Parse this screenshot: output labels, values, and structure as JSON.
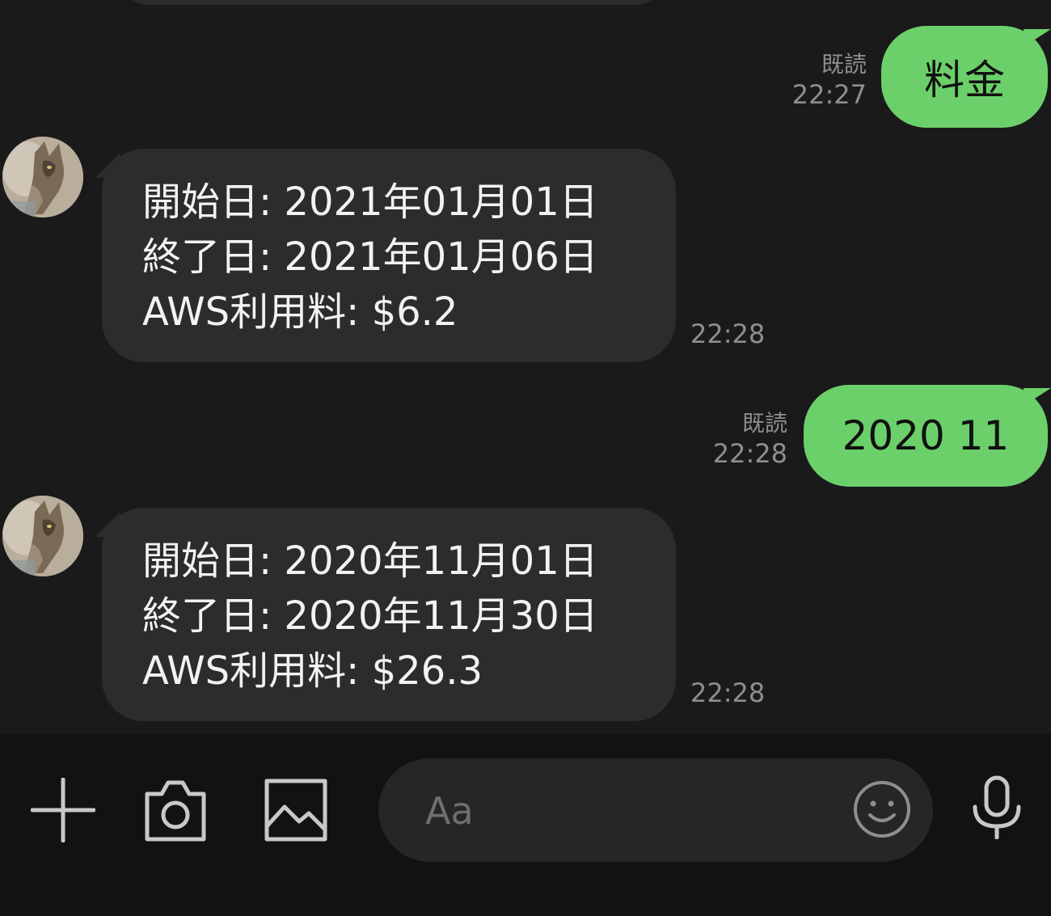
{
  "colors": {
    "background": "#1a1a1a",
    "outgoing_bubble": "#6bd06a",
    "incoming_bubble": "#2c2c2c",
    "meta_text": "#8e8e8e",
    "input_bar": "#121212"
  },
  "messages": [
    {
      "direction": "outgoing",
      "text": "料金",
      "read_label": "既読",
      "time": "22:27"
    },
    {
      "direction": "incoming",
      "lines": [
        "開始日: 2021年01月01日",
        "終了日: 2021年01月06日",
        "AWS利用料: $6.2"
      ],
      "time": "22:28",
      "avatar_icon": "cat-avatar"
    },
    {
      "direction": "outgoing",
      "text": "2020 11",
      "read_label": "既読",
      "time": "22:28"
    },
    {
      "direction": "incoming",
      "lines": [
        "開始日: 2020年11月01日",
        "終了日: 2020年11月30日",
        "AWS利用料: $26.3"
      ],
      "time": "22:28",
      "avatar_icon": "cat-avatar"
    }
  ],
  "input_bar": {
    "placeholder": "Aa",
    "icons": [
      "plus-icon",
      "camera-icon",
      "image-icon",
      "emoji-icon",
      "microphone-icon"
    ]
  }
}
